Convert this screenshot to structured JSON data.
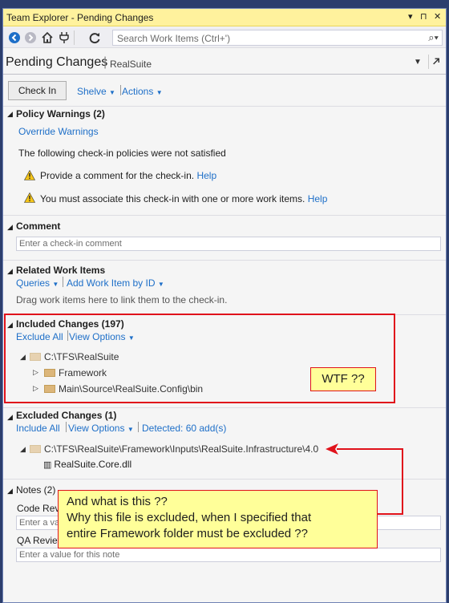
{
  "window": {
    "title": "Team Explorer - Pending Changes",
    "title_buttons": [
      "▾",
      "⊓",
      "✕"
    ]
  },
  "toolbar": {
    "search_placeholder": "Search Work Items (Ctrl+')"
  },
  "page": {
    "title": "Pending Changes",
    "context": "RealSuite"
  },
  "actions": {
    "check_in": "Check In",
    "shelve": "Shelve",
    "actions": "Actions"
  },
  "policy": {
    "title": "Policy Warnings (2)",
    "override": "Override Warnings",
    "intro": "The following check-in policies were not satisfied",
    "warnings": [
      {
        "text": "Provide a comment for the check-in.",
        "help": "Help"
      },
      {
        "text": "You must associate this check-in with one or more work items.",
        "help": "Help"
      }
    ]
  },
  "comment": {
    "title": "Comment",
    "placeholder": "Enter a check-in comment"
  },
  "work_items": {
    "title": "Related Work Items",
    "queries": "Queries",
    "add_by_id": "Add Work Item by ID",
    "hint": "Drag work items here to link them to the check-in."
  },
  "included": {
    "title": "Included Changes (197)",
    "exclude_all": "Exclude All",
    "view_options": "View Options",
    "root": "C:\\TFS\\RealSuite",
    "children": [
      "Framework",
      "Main\\Source\\RealSuite.Config\\bin"
    ]
  },
  "excluded": {
    "title": "Excluded Changes (1)",
    "include_all": "Include All",
    "view_options": "View Options",
    "detected": "Detected: 60 add(s)",
    "root": "C:\\TFS\\RealSuite\\Framework\\Inputs\\RealSuite.Infrastructure\\4.0",
    "file": "RealSuite.Core.dll"
  },
  "notes": {
    "title": "Notes (2)",
    "fields": [
      {
        "label": "Code Revi",
        "placeholder": "Enter a va"
      },
      {
        "label": "QA Review",
        "placeholder": "Enter a value for this note"
      }
    ]
  },
  "annotations": {
    "wtf": "WTF ??",
    "question_lines": [
      "And what is this ??",
      "Why this file is excluded, when I specified that",
      "entire Framework folder must be excluded ??"
    ]
  },
  "colors": {
    "accent_link": "#1e6fc8",
    "title_bar": "#fff29d",
    "annotation_red": "#e0121b",
    "callout_bg": "#ffff99"
  }
}
